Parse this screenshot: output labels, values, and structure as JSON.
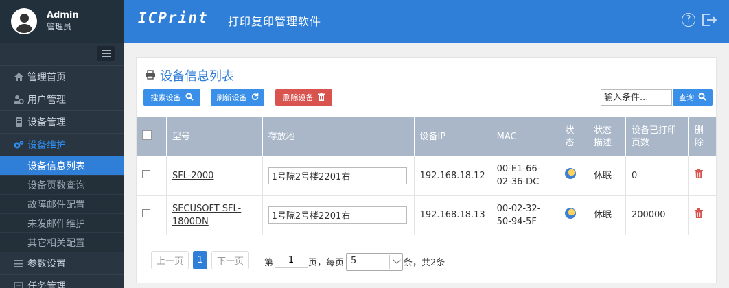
{
  "user": {
    "name": "Admin",
    "role": "管理员"
  },
  "header": {
    "logo": "ICPrint",
    "title": "打印复印管理软件"
  },
  "sidebar": {
    "items": [
      {
        "label": "管理首页",
        "icon": "home-icon"
      },
      {
        "label": "用户管理",
        "icon": "users-icon"
      },
      {
        "label": "设备管理",
        "icon": "device-icon"
      },
      {
        "label": "设备维护",
        "icon": "gears-icon"
      }
    ],
    "sub_items": [
      {
        "label": "设备信息列表"
      },
      {
        "label": "设备页数查询"
      },
      {
        "label": "故障邮件配置"
      },
      {
        "label": "未发邮件维护"
      },
      {
        "label": "其它相关配置"
      }
    ],
    "after_items": [
      {
        "label": "参数设置",
        "icon": "list-icon"
      },
      {
        "label": "任务管理",
        "icon": "task-icon"
      }
    ]
  },
  "panel": {
    "title": "设备信息列表",
    "search_btn": "搜索设备",
    "refresh_btn": "刷新设备",
    "delete_btn": "删除设备",
    "query_placeholder": "输入条件...",
    "query_btn": "查询"
  },
  "table": {
    "headers": {
      "model": "型号",
      "location": "存放地",
      "ip": "设备IP",
      "mac": "MAC",
      "status": "状态",
      "status_desc": "状态描述",
      "print_pages": "设备已打印页数",
      "delete": "删除"
    },
    "rows": [
      {
        "model": "SFL-2000",
        "location": "1号院2号楼2201右",
        "ip": "192.168.18.12",
        "mac": "00-E1-66-02-36-DC",
        "status_desc": "休眠",
        "pages": "0"
      },
      {
        "model": "SECUSOFT SFL-1800DN",
        "location": "1号院2号楼2201右",
        "ip": "192.168.18.13",
        "mac": "00-02-32-50-94-5F",
        "status_desc": "休眠",
        "pages": "200000"
      }
    ]
  },
  "pagination": {
    "prev": "上一页",
    "current": "1",
    "next": "下一页",
    "page_prefix": "第",
    "page_value": "1",
    "page_suffix": "页，每页",
    "page_size": "5",
    "total_text": "条，共2条"
  }
}
